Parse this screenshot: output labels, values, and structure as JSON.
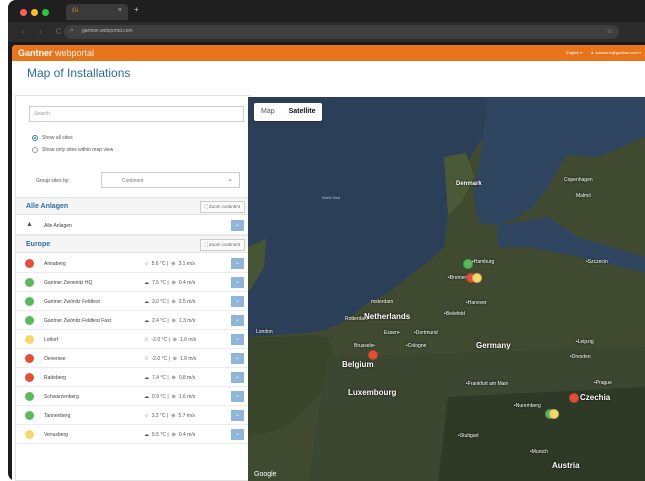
{
  "browser": {
    "tab_title": "Gi",
    "tab_close": "×",
    "new_tab": "+",
    "url": "gantner.webportal.com",
    "nav": "‹ › C",
    "dots": [
      "#ff5f57",
      "#febc2e",
      "#28c840"
    ]
  },
  "header": {
    "brand_bold": "Gantner",
    "brand_light": " webportal",
    "language": "English ▾",
    "user": "▲ someone@gantner.com ▾",
    "accent": "#e8741c"
  },
  "page_title": "Map of Installations",
  "sidebar": {
    "search_placeholder": "Search",
    "radio_all": "Show all sites",
    "radio_view": "Show only sites within map view",
    "group_label": "Group sites by:",
    "group_value": "Continent",
    "sections": {
      "alle": {
        "title": "Alle Anlagen",
        "zoom": "Zoom continent",
        "item": "Alle Anlagen"
      },
      "europe": {
        "title": "Europe",
        "zoom": "Zoom continent"
      }
    },
    "rows": [
      {
        "name": "Annaberg",
        "status": "#e0503a",
        "icon": "☼",
        "temp": "5.6 °C |",
        "wind": "3.1 m/s"
      },
      {
        "name": "Gantner Zwoenitz HQ",
        "status": "#5cb85c",
        "icon": "☁",
        "temp": "7.5 °C |",
        "wind": "0.4 m/s"
      },
      {
        "name": "Gantner Zwönitz Feldtest",
        "status": "#5cb85c",
        "icon": "☁",
        "temp": "3.0 °C |",
        "wind": "2.5 m/s"
      },
      {
        "name": "Gantner Zwönitz Feldtest Fast",
        "status": "#5cb85c",
        "icon": "☁",
        "temp": "2.4 °C |",
        "wind": "1.3 m/s"
      },
      {
        "name": "Lottorf",
        "status": "#f5d76e",
        "icon": "☃",
        "temp": "-2.0 °C |",
        "wind": "1.0 m/s"
      },
      {
        "name": "Oeversee",
        "status": "#e0503a",
        "icon": "☃",
        "temp": "-2.0 °C |",
        "wind": "1.0 m/s"
      },
      {
        "name": "Radeberg",
        "status": "#e0503a",
        "icon": "☁",
        "temp": "7.4 °C |",
        "wind": "0.8 m/s"
      },
      {
        "name": "Schwarzenberg",
        "status": "#5cb85c",
        "icon": "☁",
        "temp": "0.9 °C |",
        "wind": "1.6 m/s"
      },
      {
        "name": "Tannenberg",
        "status": "#5cb85c",
        "icon": "☼",
        "temp": "3.2 °C |",
        "wind": "5.7 m/s"
      },
      {
        "name": "Venusberg",
        "status": "#f5d76e",
        "icon": "☁",
        "temp": "5.5 °C |",
        "wind": "0.4 m/s"
      }
    ]
  },
  "map": {
    "toggle_map": "Map",
    "toggle_satellite": "Satellite",
    "google": "Google",
    "labels": {
      "north_sea": "North Sea",
      "denmark": "Denmark",
      "copenhagen": "Copenhagen",
      "hamburg": "•Hamburg",
      "bremen": "•Bremen",
      "amsterdam": "msterdam",
      "netherlands": "Netherlands",
      "rotterdam": "Rotterdam",
      "hanover": "•Hanover",
      "bielefeld": "•Bielefeld",
      "dortmund": "•Dortmund",
      "essen": "Essen•",
      "london": "London",
      "brussels": "Brussels•",
      "cologne": "•Cologne",
      "germany": "Germany",
      "belgium": "Belgium",
      "luxembourg": "Luxembourg",
      "frankfurt": "•Frankfurt am Main",
      "nuremberg": "•Nuremberg",
      "czechia": "Czechia",
      "dresden": "•Dresden",
      "austria": "Austria",
      "malmo": "Malmö",
      "szczecin": "•Szczecin",
      "leipzig": "•Leipzig",
      "prague": "•Prague",
      "munich": "•Munich",
      "stuttgart": "•Stuttgart"
    }
  }
}
